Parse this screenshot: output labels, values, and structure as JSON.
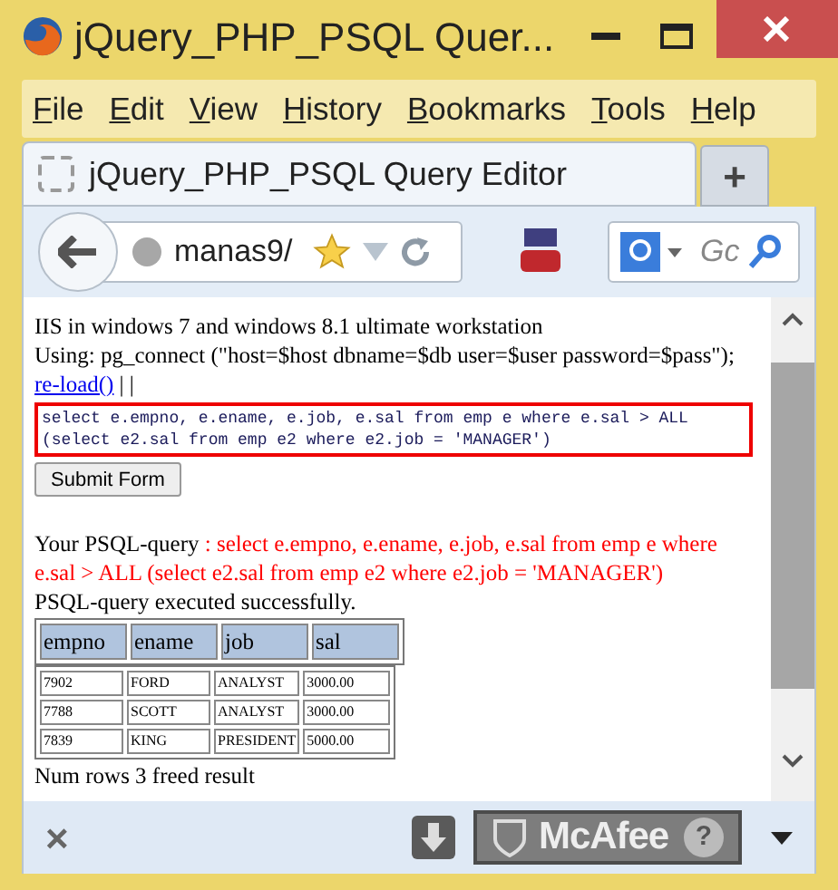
{
  "window": {
    "title": "jQuery_PHP_PSQL Quer..."
  },
  "menu": [
    {
      "label": "File"
    },
    {
      "label": "Edit"
    },
    {
      "label": "View"
    },
    {
      "label": "History"
    },
    {
      "label": "Bookmarks"
    },
    {
      "label": "Tools"
    },
    {
      "label": "Help"
    }
  ],
  "tabs": [
    {
      "label": "jQuery_PHP_PSQL Query Editor",
      "selected": true
    }
  ],
  "new_tab": "+",
  "address_bar": {
    "value": "manas9/"
  },
  "search_field": {
    "placeholder": "Gc"
  },
  "page": {
    "lines": [
      "IIS in windows 7 and windows 8.1 ultimate workstation",
      "Using: pg_connect (\"host=$host dbname=$db user=$user password=$pass\");"
    ],
    "reload_link": "re-load()",
    "separator": "| |",
    "query_input": "select e.empno, e.ename, e.job, e.sal from emp e where e.sal > ALL (select e2.sal from emp e2 where e2.job = 'MANAGER')",
    "submit": "Submit Form",
    "echo_label": "Your PSQL-query ",
    "echo_query": ": select e.empno, e.ename, e.job, e.sal from emp e where e.sal > ALL (select e2.sal from emp e2 where e2.job = 'MANAGER')",
    "status": "PSQL-query executed successfully.",
    "table": {
      "columns": [
        "empno",
        "ename",
        "job",
        "sal"
      ],
      "rows": [
        [
          "7902",
          "FORD",
          "ANALYST",
          "3000.00"
        ],
        [
          "7788",
          "SCOTT",
          "ANALYST",
          "3000.00"
        ],
        [
          "7839",
          "KING",
          "PRESIDENT",
          "5000.00"
        ]
      ]
    },
    "footer": "Num rows 3 freed result"
  },
  "addon_bar": {
    "close": "×",
    "mcafee": "McAfee",
    "help": "?"
  }
}
